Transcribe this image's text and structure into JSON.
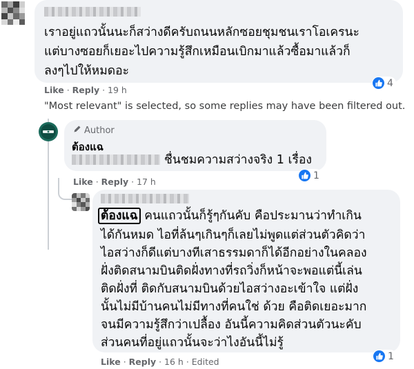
{
  "comment1": {
    "lines": [
      "เราอยู่แถวนั้นนะก็สว่างดีครับถนนหลักซอยชุมชนเราโอเครนะ",
      "แต่บางซอยก็เยอะไปความรู้สึกเหมือนเบิกมาแล้วซื้อมาแล้วก็",
      "ลงๆไปให้หมดอะ"
    ],
    "like": "Like",
    "reply": "Reply",
    "time": "19 h",
    "reaction_count": "4"
  },
  "filter_notice": "\"Most relevant\" is selected, so some replies may have been filtered out.",
  "reply1": {
    "badge_icon": "pencil-icon",
    "badge_label": "Author",
    "author_name": "ต้องแฉ",
    "text": "ชื่นชมความสว่างจริง 1 เรื่อง",
    "like": "Like",
    "reply": "Reply",
    "time": "17 h",
    "reaction_count": "1"
  },
  "reply2": {
    "tag_name": "ต้องแฉ",
    "first_line_rest": "คนแถวนั้นก็รู้ๆกันคับ คือประมานว่าทำเกิน",
    "lines": [
      "ได้กันหมด ไอที่ล้นๆเกินๆก็เลยไม่พูดแต่ส่วนตัวคิดว่า",
      "ไอสว่างก็ดีแต่บางทีเสาธรรมดาก็ได้อีกอย่างในคลอง",
      "ฝั่งติดสนามบินติดฝั่งทางที่รถวิ่งก็หน้าจะพอแต่นี้เล่น",
      "ติดฝั่งที่ ติดกับสนามบินด้วยไอสว่างอะเข้าใจ แต่ฝั่ง",
      "นั้นไม่มีบ้านคนไม่มีทางที่คนใช่ ด้วย คือติดเยอะมาก",
      "จนมีความรู้สึกว่าเปลื้อง อันนี้ความคิดส่วนตัวนะคับ",
      "ส่วนคนที่อยู่แถวนั้นจะว่าไงอันนี้ไม่รู้"
    ],
    "like": "Like",
    "reply": "Reply",
    "time": "16 h",
    "edited": "Edited",
    "reaction_count": "1"
  },
  "colors": {
    "accent": "#1877f2",
    "bubble": "#f0f2f5",
    "meta": "#65676b",
    "author_avatar": "#1c6b5c"
  }
}
